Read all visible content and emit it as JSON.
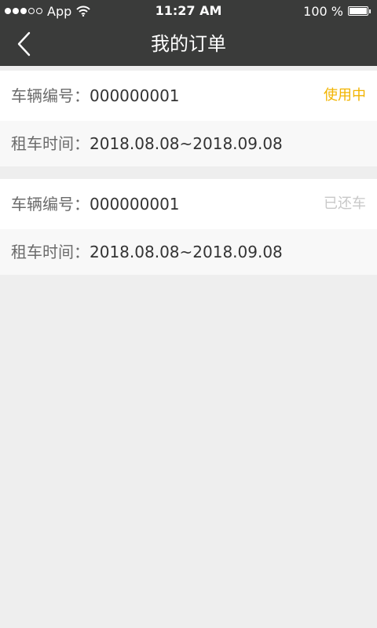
{
  "status_bar": {
    "carrier": "App",
    "time": "11:27 AM",
    "battery_pct": "100 %",
    "signal_bars_filled": 3,
    "signal_bars_total": 5,
    "battery_level": 1.0
  },
  "nav": {
    "title": "我的订单",
    "back_icon": "chevron-left-icon"
  },
  "orders": [
    {
      "vehicle_label": "车辆编号：",
      "vehicle_no": "000000001",
      "status": "使用中",
      "status_color": "#f2b400",
      "period_label": "租车时间：",
      "period": "2018.08.08~2018.09.08"
    },
    {
      "vehicle_label": "车辆编号：",
      "vehicle_no": "000000001",
      "status": "已还车",
      "status_color": "#c8c8c8",
      "period_label": "租车时间：",
      "period": "2018.08.08~2018.09.08"
    }
  ],
  "colors": {
    "header_bg": "#3a3b3a",
    "page_bg": "#eeeeee",
    "accent": "#f2b400"
  }
}
